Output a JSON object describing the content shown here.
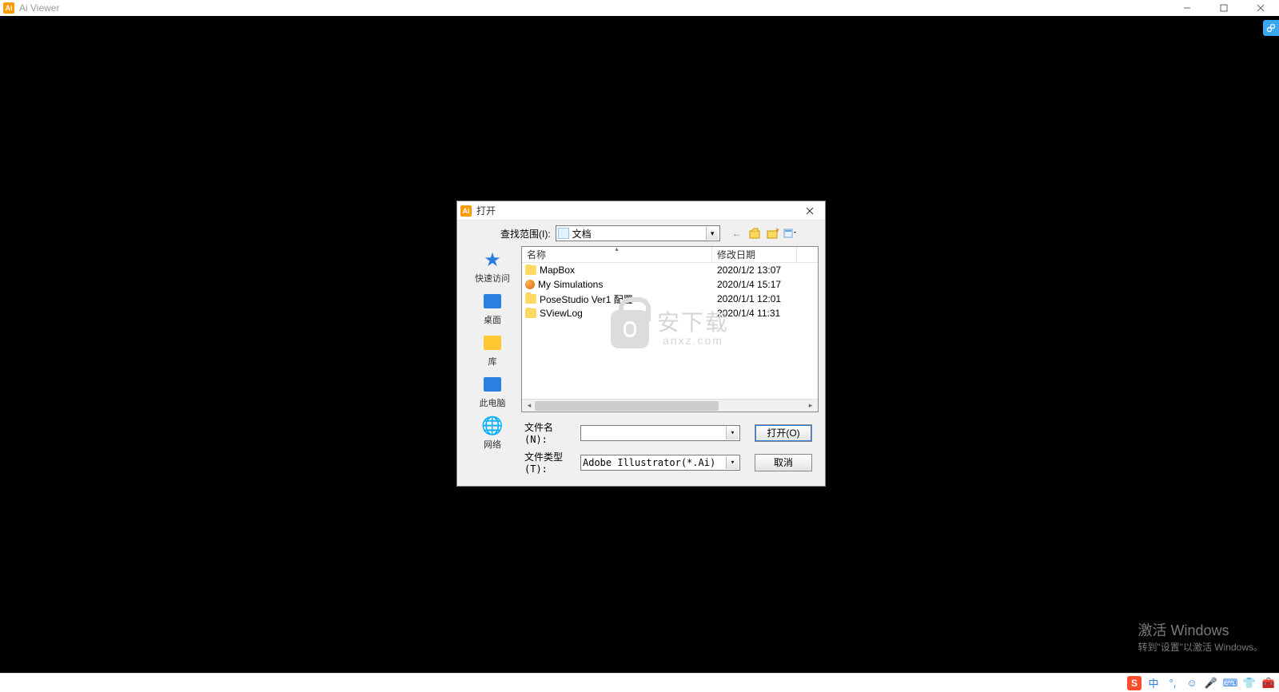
{
  "app": {
    "title": "Ai Viewer"
  },
  "dialog": {
    "title": "打开",
    "lookin_label": "查找范围(I):",
    "lookin_value": "文档",
    "columns": {
      "name": "名称",
      "date": "修改日期"
    },
    "files": [
      {
        "name": "MapBox",
        "date": "2020/1/2 13:07",
        "icon": "folder"
      },
      {
        "name": "My Simulations",
        "date": "2020/1/4 15:17",
        "icon": "globe"
      },
      {
        "name": "PoseStudio Ver1 配置",
        "date": "2020/1/1 12:01",
        "icon": "folder"
      },
      {
        "name": "SViewLog",
        "date": "2020/1/4 11:31",
        "icon": "folder"
      }
    ],
    "filename_label": "文件名(N):",
    "filename_value": "",
    "filetype_label": "文件类型(T):",
    "filetype_value": "Adobe Illustrator(*.Ai)",
    "open_button": "打开(O)",
    "cancel_button": "取消",
    "places": {
      "quick_access": "快速访问",
      "desktop": "桌面",
      "library": "库",
      "this_pc": "此电脑",
      "network": "网络"
    }
  },
  "watermark": {
    "title": "安下载",
    "sub": "anxz.com"
  },
  "activation": {
    "line1": "激活 Windows",
    "line2": "转到\"设置\"以激活 Windows。"
  },
  "tray": {
    "sogou": "S",
    "ime": "中"
  }
}
